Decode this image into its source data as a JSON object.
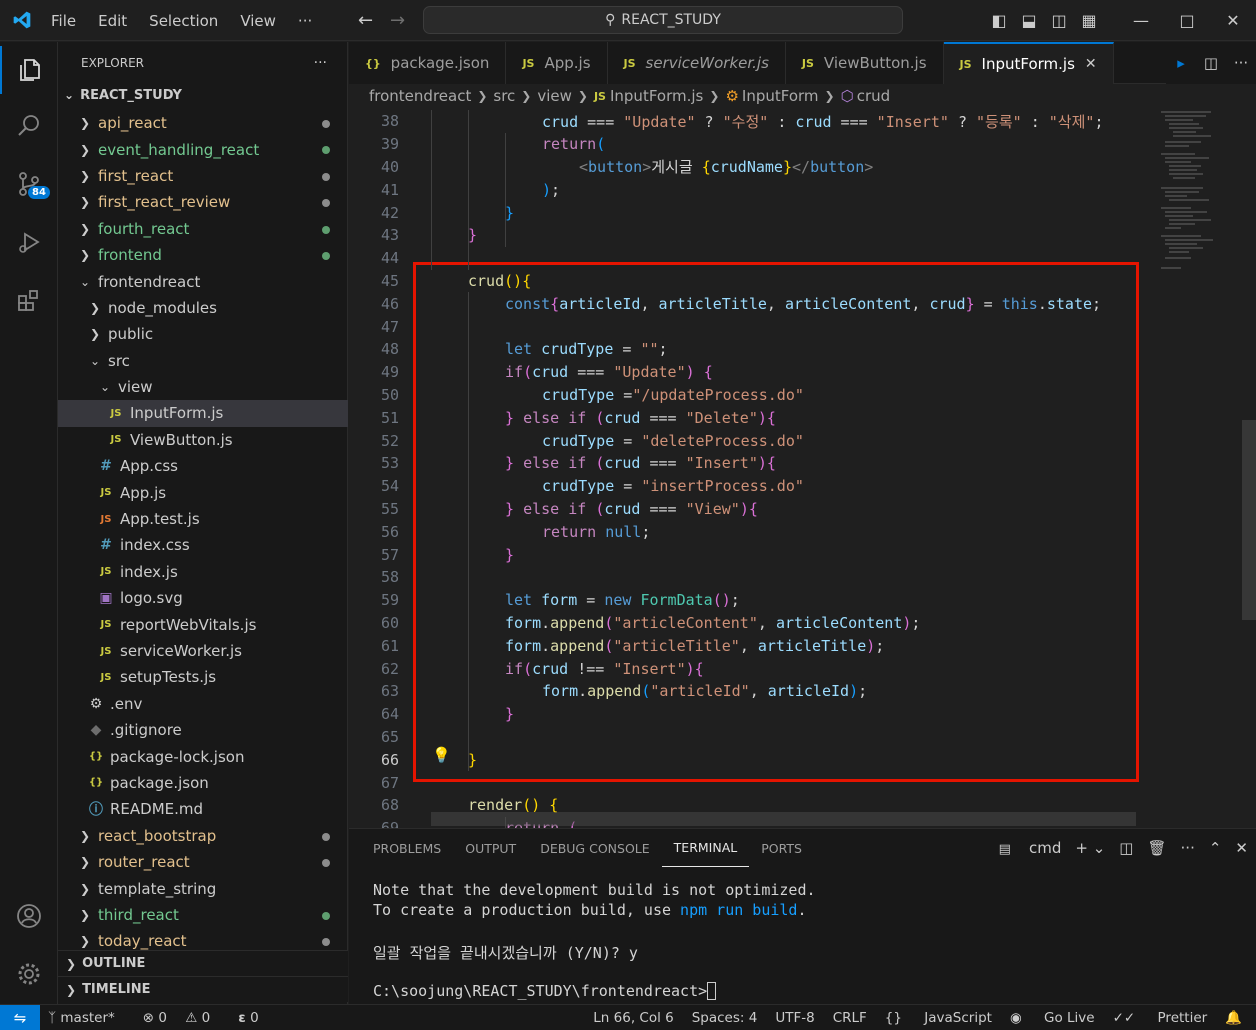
{
  "menu": [
    "File",
    "Edit",
    "Selection",
    "View",
    "···"
  ],
  "search": {
    "text": "REACT_STUDY"
  },
  "activity": {
    "scm_badge": "84"
  },
  "explorer": {
    "title": "EXPLORER",
    "more": "···",
    "root": "REACT_STUDY",
    "items": [
      {
        "label": "api_react",
        "type": "folder",
        "color": "#e2c08d",
        "dot": "#8c8c8c"
      },
      {
        "label": "event_handling_react",
        "type": "folder",
        "color": "#73c991",
        "dot": "#5e9e6f"
      },
      {
        "label": "first_react",
        "type": "folder",
        "color": "#e2c08d",
        "dot": "#8c8c8c"
      },
      {
        "label": "first_react_review",
        "type": "folder",
        "color": "#e2c08d",
        "dot": "#8c8c8c"
      },
      {
        "label": "fourth_react",
        "type": "folder",
        "color": "#73c991",
        "dot": "#5e9e6f"
      },
      {
        "label": "frontend",
        "type": "folder",
        "color": "#73c991",
        "dot": "#5e9e6f"
      },
      {
        "label": "frontendreact",
        "type": "folder-open",
        "color": "#cccccc"
      },
      {
        "label": "node_modules",
        "type": "folder",
        "color": "#cccccc",
        "indent": 1
      },
      {
        "label": "public",
        "type": "folder",
        "color": "#cccccc",
        "indent": 1
      },
      {
        "label": "src",
        "type": "folder-open",
        "color": "#cccccc",
        "indent": 1
      },
      {
        "label": "view",
        "type": "folder-open",
        "color": "#cccccc",
        "indent": 2
      },
      {
        "label": "InputForm.js",
        "type": "js",
        "color": "#cccccc",
        "indent": 3,
        "selected": true
      },
      {
        "label": "ViewButton.js",
        "type": "js",
        "color": "#cccccc",
        "indent": 3
      },
      {
        "label": "App.css",
        "type": "css",
        "color": "#cccccc",
        "indent": 2
      },
      {
        "label": "App.js",
        "type": "js",
        "color": "#cccccc",
        "indent": 2
      },
      {
        "label": "App.test.js",
        "type": "test",
        "color": "#cccccc",
        "indent": 2
      },
      {
        "label": "index.css",
        "type": "css",
        "color": "#cccccc",
        "indent": 2
      },
      {
        "label": "index.js",
        "type": "js",
        "color": "#cccccc",
        "indent": 2
      },
      {
        "label": "logo.svg",
        "type": "svg",
        "color": "#cccccc",
        "indent": 2
      },
      {
        "label": "reportWebVitals.js",
        "type": "js",
        "color": "#cccccc",
        "indent": 2
      },
      {
        "label": "serviceWorker.js",
        "type": "js",
        "color": "#cccccc",
        "indent": 2
      },
      {
        "label": "setupTests.js",
        "type": "js",
        "color": "#cccccc",
        "indent": 2
      },
      {
        "label": ".env",
        "type": "env",
        "color": "#cccccc",
        "indent": 1
      },
      {
        "label": ".gitignore",
        "type": "git",
        "color": "#cccccc",
        "indent": 1
      },
      {
        "label": "package-lock.json",
        "type": "json",
        "color": "#cccccc",
        "indent": 1
      },
      {
        "label": "package.json",
        "type": "json",
        "color": "#cccccc",
        "indent": 1
      },
      {
        "label": "README.md",
        "type": "info",
        "color": "#cccccc",
        "indent": 1
      },
      {
        "label": "react_bootstrap",
        "type": "folder",
        "color": "#e2c08d",
        "dot": "#8c8c8c"
      },
      {
        "label": "router_react",
        "type": "folder",
        "color": "#e2c08d",
        "dot": "#8c8c8c"
      },
      {
        "label": "template_string",
        "type": "folder",
        "color": "#cccccc"
      },
      {
        "label": "third_react",
        "type": "folder",
        "color": "#73c991",
        "dot": "#5e9e6f"
      },
      {
        "label": "today_react",
        "type": "folder",
        "color": "#e2c08d",
        "dot": "#8c8c8c"
      }
    ],
    "outline": "OUTLINE",
    "timeline": "TIMELINE"
  },
  "tabs": [
    {
      "icon": "{}",
      "label": "package.json",
      "italic": false
    },
    {
      "icon": "JS",
      "label": "App.js",
      "italic": false
    },
    {
      "icon": "JS",
      "label": "serviceWorker.js",
      "italic": true
    },
    {
      "icon": "JS",
      "label": "ViewButton.js",
      "italic": false
    },
    {
      "icon": "JS",
      "label": "InputForm.js",
      "italic": false,
      "active": true
    }
  ],
  "breadcrumb": [
    "frontendreact",
    "src",
    "view",
    "InputForm.js",
    "InputForm",
    "crud"
  ],
  "code": [
    {
      "n": "38",
      "ind": 2,
      "t": [
        [
          "var",
          "crud"
        ],
        [
          "pun",
          " === "
        ],
        [
          "str",
          "\"Update\""
        ],
        [
          "pun",
          " ? "
        ],
        [
          "str",
          "\"수정\""
        ],
        [
          "pun",
          " : "
        ],
        [
          "var",
          "crud"
        ],
        [
          "pun",
          " === "
        ],
        [
          "str",
          "\"Insert\""
        ],
        [
          "pun",
          " ? "
        ],
        [
          "str",
          "\"등록\""
        ],
        [
          "pun",
          " : "
        ],
        [
          "str",
          "\"삭제\""
        ],
        [
          "pun",
          ";"
        ]
      ]
    },
    {
      "n": "39",
      "ind": 2,
      "t": [
        [
          "ctl",
          "return"
        ],
        [
          "br3",
          "("
        ]
      ]
    },
    {
      "n": "40",
      "ind": 3,
      "t": [
        [
          "tag",
          "<"
        ],
        [
          "tagn",
          "button"
        ],
        [
          "tag",
          ">"
        ],
        [
          "txt",
          "게시글 "
        ],
        [
          "br1",
          "{"
        ],
        [
          "var",
          "crudName"
        ],
        [
          "br1",
          "}"
        ],
        [
          "tag",
          "</"
        ],
        [
          "tagn",
          "button"
        ],
        [
          "tag",
          ">"
        ]
      ]
    },
    {
      "n": "41",
      "ind": 2,
      "t": [
        [
          "br3",
          ")"
        ],
        [
          "pun",
          ";"
        ]
      ]
    },
    {
      "n": "42",
      "ind": 1,
      "t": [
        [
          "br3",
          "}"
        ]
      ]
    },
    {
      "n": "43",
      "ind": 0,
      "t": [
        [
          "br2",
          "}"
        ]
      ]
    },
    {
      "n": "44",
      "ind": 0,
      "t": []
    },
    {
      "n": "45",
      "ind": 0,
      "t": [
        [
          "fn",
          "crud"
        ],
        [
          "br1",
          "()"
        ],
        [
          "br1",
          "{"
        ]
      ]
    },
    {
      "n": "46",
      "ind": 1,
      "t": [
        [
          "kw",
          "const"
        ],
        [
          "br2",
          "{"
        ],
        [
          "var",
          "articleId"
        ],
        [
          "pun",
          ", "
        ],
        [
          "var",
          "articleTitle"
        ],
        [
          "pun",
          ", "
        ],
        [
          "var",
          "articleContent"
        ],
        [
          "pun",
          ", "
        ],
        [
          "var",
          "crud"
        ],
        [
          "br2",
          "}"
        ],
        [
          "pun",
          " = "
        ],
        [
          "kw",
          "this"
        ],
        [
          "pun",
          "."
        ],
        [
          "var",
          "state"
        ],
        [
          "pun",
          ";"
        ]
      ]
    },
    {
      "n": "47",
      "ind": 0,
      "t": []
    },
    {
      "n": "48",
      "ind": 1,
      "t": [
        [
          "kw",
          "let"
        ],
        [
          "pun",
          " "
        ],
        [
          "var",
          "crudType"
        ],
        [
          "pun",
          " = "
        ],
        [
          "str",
          "\"\""
        ],
        [
          "pun",
          ";"
        ]
      ]
    },
    {
      "n": "49",
      "ind": 1,
      "t": [
        [
          "ctl",
          "if"
        ],
        [
          "br2",
          "("
        ],
        [
          "var",
          "crud"
        ],
        [
          "pun",
          " === "
        ],
        [
          "str",
          "\"Update\""
        ],
        [
          "br2",
          ")"
        ],
        [
          "pun",
          " "
        ],
        [
          "br2",
          "{"
        ]
      ]
    },
    {
      "n": "50",
      "ind": 2,
      "t": [
        [
          "var",
          "crudType"
        ],
        [
          "pun",
          " ="
        ],
        [
          "str",
          "\"/updateProcess.do\""
        ]
      ]
    },
    {
      "n": "51",
      "ind": 1,
      "t": [
        [
          "br2",
          "}"
        ],
        [
          "pun",
          " "
        ],
        [
          "ctl",
          "else if"
        ],
        [
          "pun",
          " "
        ],
        [
          "br2",
          "("
        ],
        [
          "var",
          "crud"
        ],
        [
          "pun",
          " === "
        ],
        [
          "str",
          "\"Delete\""
        ],
        [
          "br2",
          ")"
        ],
        [
          "br2",
          "{"
        ]
      ]
    },
    {
      "n": "52",
      "ind": 2,
      "t": [
        [
          "var",
          "crudType"
        ],
        [
          "pun",
          " = "
        ],
        [
          "str",
          "\"deleteProcess.do\""
        ]
      ]
    },
    {
      "n": "53",
      "ind": 1,
      "t": [
        [
          "br2",
          "}"
        ],
        [
          "pun",
          " "
        ],
        [
          "ctl",
          "else if"
        ],
        [
          "pun",
          " "
        ],
        [
          "br2",
          "("
        ],
        [
          "var",
          "crud"
        ],
        [
          "pun",
          " === "
        ],
        [
          "str",
          "\"Insert\""
        ],
        [
          "br2",
          ")"
        ],
        [
          "br2",
          "{"
        ]
      ]
    },
    {
      "n": "54",
      "ind": 2,
      "t": [
        [
          "var",
          "crudType"
        ],
        [
          "pun",
          " = "
        ],
        [
          "str",
          "\"insertProcess.do\""
        ]
      ]
    },
    {
      "n": "55",
      "ind": 1,
      "t": [
        [
          "br2",
          "}"
        ],
        [
          "pun",
          " "
        ],
        [
          "ctl",
          "else if"
        ],
        [
          "pun",
          " "
        ],
        [
          "br2",
          "("
        ],
        [
          "var",
          "crud"
        ],
        [
          "pun",
          " === "
        ],
        [
          "str",
          "\"View\""
        ],
        [
          "br2",
          ")"
        ],
        [
          "br2",
          "{"
        ]
      ]
    },
    {
      "n": "56",
      "ind": 2,
      "t": [
        [
          "ctl",
          "return"
        ],
        [
          "pun",
          " "
        ],
        [
          "kw",
          "null"
        ],
        [
          "pun",
          ";"
        ]
      ]
    },
    {
      "n": "57",
      "ind": 1,
      "t": [
        [
          "br2",
          "}"
        ]
      ]
    },
    {
      "n": "58",
      "ind": 0,
      "t": []
    },
    {
      "n": "59",
      "ind": 1,
      "t": [
        [
          "kw",
          "let"
        ],
        [
          "pun",
          " "
        ],
        [
          "var",
          "form"
        ],
        [
          "pun",
          " = "
        ],
        [
          "kw",
          "new"
        ],
        [
          "pun",
          " "
        ],
        [
          "cls",
          "FormData"
        ],
        [
          "br2",
          "()"
        ],
        [
          "pun",
          ";"
        ]
      ]
    },
    {
      "n": "60",
      "ind": 1,
      "t": [
        [
          "var",
          "form"
        ],
        [
          "pun",
          "."
        ],
        [
          "fn",
          "append"
        ],
        [
          "br2",
          "("
        ],
        [
          "str",
          "\"articleContent\""
        ],
        [
          "pun",
          ", "
        ],
        [
          "var",
          "articleContent"
        ],
        [
          "br2",
          ")"
        ],
        [
          "pun",
          ";"
        ]
      ]
    },
    {
      "n": "61",
      "ind": 1,
      "t": [
        [
          "var",
          "form"
        ],
        [
          "pun",
          "."
        ],
        [
          "fn",
          "append"
        ],
        [
          "br2",
          "("
        ],
        [
          "str",
          "\"articleTitle\""
        ],
        [
          "pun",
          ", "
        ],
        [
          "var",
          "articleTitle"
        ],
        [
          "br2",
          ")"
        ],
        [
          "pun",
          ";"
        ]
      ]
    },
    {
      "n": "62",
      "ind": 1,
      "t": [
        [
          "ctl",
          "if"
        ],
        [
          "br2",
          "("
        ],
        [
          "var",
          "crud"
        ],
        [
          "pun",
          " !== "
        ],
        [
          "str",
          "\"Insert\""
        ],
        [
          "br2",
          ")"
        ],
        [
          "br2",
          "{"
        ]
      ]
    },
    {
      "n": "63",
      "ind": 2,
      "t": [
        [
          "var",
          "form"
        ],
        [
          "pun",
          "."
        ],
        [
          "fn",
          "append"
        ],
        [
          "br3",
          "("
        ],
        [
          "str",
          "\"articleId\""
        ],
        [
          "pun",
          ", "
        ],
        [
          "var",
          "articleId"
        ],
        [
          "br3",
          ")"
        ],
        [
          "pun",
          ";"
        ]
      ]
    },
    {
      "n": "64",
      "ind": 1,
      "t": [
        [
          "br2",
          "}"
        ]
      ]
    },
    {
      "n": "65",
      "ind": 0,
      "t": []
    },
    {
      "n": "66",
      "ind": 0,
      "t": [
        [
          "br1",
          "}"
        ]
      ],
      "current": true
    },
    {
      "n": "67",
      "ind": 0,
      "t": []
    },
    {
      "n": "68",
      "ind": 0,
      "t": [
        [
          "fn",
          "render"
        ],
        [
          "br1",
          "()"
        ],
        [
          "pun",
          " "
        ],
        [
          "br1",
          "{"
        ]
      ]
    },
    {
      "n": "69",
      "ind": 1,
      "t": [
        [
          "ctl",
          "return"
        ],
        [
          "pun",
          " "
        ],
        [
          "br2",
          "("
        ]
      ]
    }
  ],
  "panel": {
    "tabs": [
      "PROBLEMS",
      "OUTPUT",
      "DEBUG CONSOLE",
      "TERMINAL",
      "PORTS"
    ],
    "active": "TERMINAL",
    "shell": "cmd",
    "lines": [
      [
        [
          "pun",
          "Note that the development build is not optimized."
        ]
      ],
      [
        [
          "pun",
          "To create a production build, use "
        ],
        [
          "br3",
          "npm run build"
        ],
        [
          "pun",
          "."
        ]
      ],
      [],
      [
        [
          "pun",
          "일괄 작업을 끝내시겠습니까 (Y/N)? y"
        ]
      ],
      [],
      [
        [
          "pun",
          "C:\\soojung\\REACT_STUDY\\frontendreact>"
        ]
      ]
    ]
  },
  "status": {
    "branch": "master*",
    "errors": "0",
    "warnings": "0",
    "ports": "0",
    "position": "Ln 66, Col 6",
    "spaces": "Spaces: 4",
    "encoding": "UTF-8",
    "eol": "CRLF",
    "language": "JavaScript",
    "golive": "Go Live",
    "prettier": "Prettier"
  }
}
